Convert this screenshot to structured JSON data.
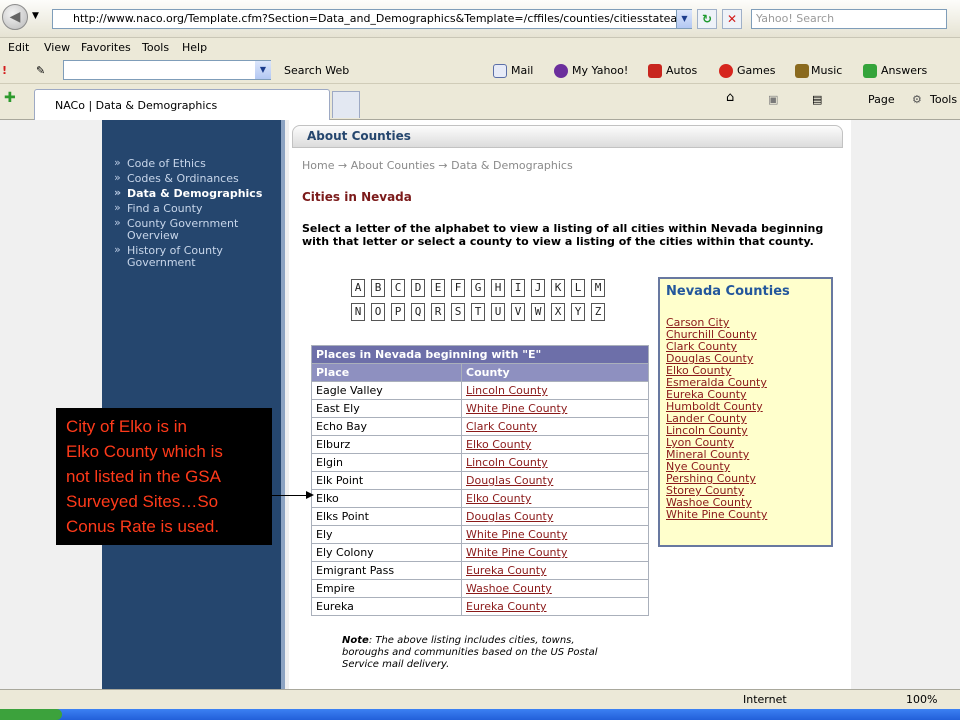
{
  "browser": {
    "url": "http://www.naco.org/Template.cfm?Section=Data_and_Demographics&Template=/cffiles/counties/citiesstateall.cfm",
    "search_placeholder": "Yahoo! Search",
    "menu": [
      "Edit",
      "View",
      "Favorites",
      "Tools",
      "Help"
    ],
    "yahoo_toolbar": {
      "search_web": "Search Web",
      "items": [
        "Mail",
        "My Yahoo!",
        "Autos",
        "Games",
        "Music",
        "Answers"
      ]
    },
    "tab_title": "NACo | Data & Demographics",
    "tools": {
      "page": "Page",
      "tools": "Tools"
    },
    "status": {
      "zone": "Internet",
      "zoom": "100%"
    }
  },
  "sidebar": {
    "items": [
      "Code of Ethics",
      "Codes & Ordinances",
      "Data & Demographics",
      "Find a County",
      "County Government Overview",
      "History of County Government"
    ],
    "active_index": 2
  },
  "main": {
    "header": "About Counties",
    "breadcrumb": "Home → About Counties → Data & Demographics",
    "title": "Cities in Nevada",
    "intro": "Select a letter of the alphabet to view a listing of all cities within Nevada beginning with that letter or select a county to view a listing of the cities within that county.",
    "letters_row1": [
      "A",
      "B",
      "C",
      "D",
      "E",
      "F",
      "G",
      "H",
      "I",
      "J",
      "K",
      "L",
      "M"
    ],
    "letters_row2": [
      "N",
      "O",
      "P",
      "Q",
      "R",
      "S",
      "T",
      "U",
      "V",
      "W",
      "X",
      "Y",
      "Z"
    ],
    "table": {
      "caption": "Places in Nevada beginning with \"E\"",
      "headers": [
        "Place",
        "County"
      ],
      "rows": [
        [
          "Eagle Valley",
          "Lincoln County"
        ],
        [
          "East Ely",
          "White Pine County"
        ],
        [
          "Echo Bay",
          "Clark County"
        ],
        [
          "Elburz",
          "Elko County"
        ],
        [
          "Elgin",
          "Lincoln County"
        ],
        [
          "Elk Point",
          "Douglas County"
        ],
        [
          "Elko",
          "Elko County"
        ],
        [
          "Elks Point",
          "Douglas County"
        ],
        [
          "Ely",
          "White Pine County"
        ],
        [
          "Ely Colony",
          "White Pine County"
        ],
        [
          "Emigrant Pass",
          "Eureka County"
        ],
        [
          "Empire",
          "Washoe County"
        ],
        [
          "Eureka",
          "Eureka County"
        ]
      ]
    },
    "note_label": "Note",
    "note_text": ": The above listing includes cities, towns, boroughs and communities based on the US Postal Service mail delivery.",
    "counties_title": "Nevada Counties",
    "counties": [
      "Carson City",
      "Churchill County",
      "Clark County",
      "Douglas County",
      "Elko County",
      "Esmeralda County",
      "Eureka County",
      "Humboldt County",
      "Lander County",
      "Lincoln County",
      "Lyon County",
      "Mineral County",
      "Nye County",
      "Pershing County",
      "Storey County",
      "Washoe County",
      "White Pine County"
    ]
  },
  "annotation": {
    "lines": [
      "City of Elko is in",
      "Elko County which is",
      "not listed in the GSA",
      "Surveyed Sites…So",
      "Conus Rate is used."
    ]
  }
}
